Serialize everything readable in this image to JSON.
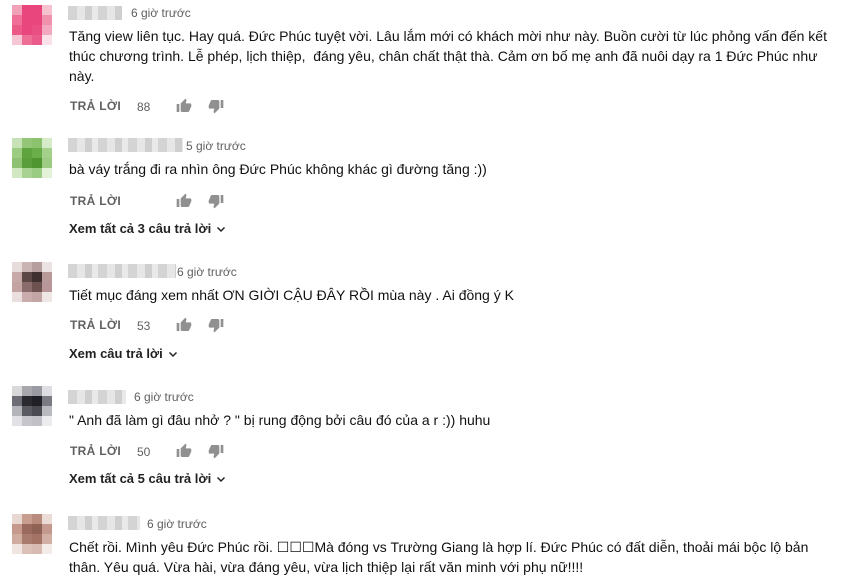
{
  "labels": {
    "reply": "TRẢ LỜI"
  },
  "comments": [
    {
      "time": "6 giờ trước",
      "text": "Tăng view liên tục. Hay quá. Đức Phúc tuyệt vời. Lâu lắm mới có khách mời như này. Buồn cười từ lúc phỏng vấn đến kết thúc chương trình. Lễ phép, lịch thiệp,  đáng yêu, chân chất thật thà. Cảm ơn bố mẹ anh đã nuôi dạy ra 1 Đức Phúc như này.",
      "likes": "88",
      "view_replies": "",
      "avatar_colors": [
        "#f2a2b8",
        "#e8467c",
        "#e8467c",
        "#f7c2d0",
        "#ef6f98",
        "#e8467c",
        "#e8467c",
        "#f091ae",
        "#ec5a88",
        "#e8467c",
        "#e94f83",
        "#f3aac0",
        "#f6c6d4",
        "#ee6f96",
        "#ea5a8a",
        "#fbe1e8"
      ]
    },
    {
      "time": "5 giờ trước",
      "text": "bà váy trắng đi ra nhìn ông Đức Phúc không khác gì đường tăng :))",
      "likes": "",
      "view_replies": "Xem tất cả 3 câu trả lời",
      "avatar_colors": [
        "#c7e2b6",
        "#93c777",
        "#8cc26e",
        "#d6ebc8",
        "#9ccb82",
        "#5fa33f",
        "#6aae4a",
        "#a4d08c",
        "#8fc172",
        "#5a9e3b",
        "#4f9631",
        "#9dcb84",
        "#d2e8c3",
        "#a7d291",
        "#9bcc83",
        "#e3f1d9"
      ]
    },
    {
      "time": "6 giờ trước",
      "text": "Tiết mục đáng xem nhất ƠN GIỜI CẬU ĐÂY RỒI mùa này . Ai đồng ý K",
      "likes": "53",
      "view_replies": "Xem câu trả lời",
      "avatar_colors": [
        "#e6dcdc",
        "#c9b3b3",
        "#b79e9e",
        "#ebe3e3",
        "#c8a9a9",
        "#5c4747",
        "#3f3030",
        "#b99a9a",
        "#c4a3a3",
        "#8a6c6c",
        "#6d5252",
        "#b8969a",
        "#eadede",
        "#c9adad",
        "#c2a5a5",
        "#efe6e6"
      ]
    },
    {
      "time": "6 giờ trước",
      "text": "\" Anh đã làm gì đâu nhở ? \" bị rung động bởi câu đó của a r :)) huhu",
      "likes": "50",
      "view_replies": "Xem tất cả 5 câu trả lời",
      "avatar_colors": [
        "#d9d9dc",
        "#a7a7ad",
        "#9a9aa2",
        "#dedee2",
        "#6d6d75",
        "#2a2a30",
        "#1f1f25",
        "#7a7a82",
        "#b3b3ba",
        "#5a5a62",
        "#4a4a52",
        "#b9b9c0",
        "#e2e2e6",
        "#c5c5cb",
        "#c0c0c6",
        "#ececef"
      ]
    },
    {
      "time": "6 giờ trước",
      "text": "Chết rồi. Mình yêu Đức Phúc rồi. ☐☐☐Mà đóng vs Trường Giang là hợp lí. Đức Phúc có đất diễn, thoải mái bộc lộ bản thân. Yêu quá. Vừa hài, vừa đáng yêu, vừa lịch thiệp lại rất văn minh với phụ nữ!!!!",
      "likes": "",
      "view_replies": "",
      "avatar_colors": [
        "#e9d8d2",
        "#c79d8f",
        "#b98b7d",
        "#eadbd6",
        "#c7998c",
        "#9a6a5e",
        "#8f6256",
        "#c49a8e",
        "#d0aba0",
        "#a97b6e",
        "#a57366",
        "#d2afa5",
        "#f0e5e1",
        "#dcc1b9",
        "#d8bbb3",
        "#f3ebe8"
      ]
    }
  ]
}
